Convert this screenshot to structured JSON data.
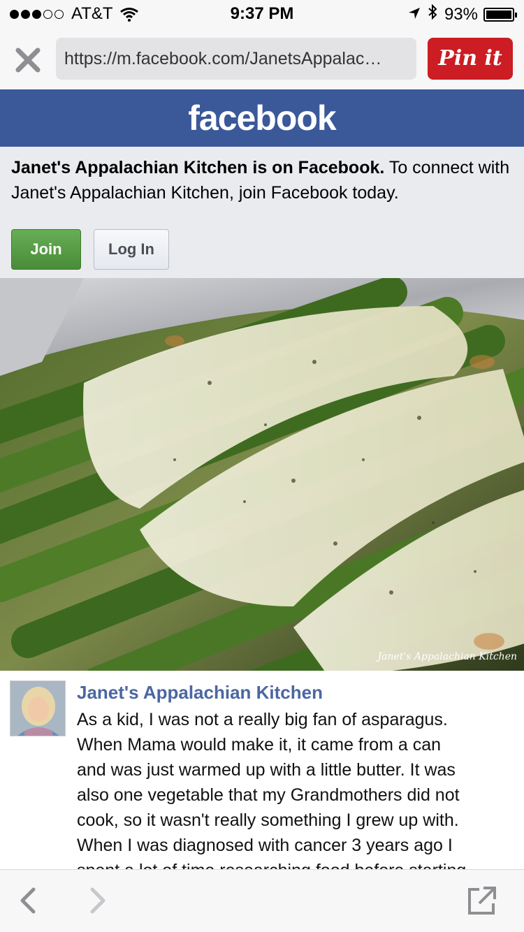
{
  "status_bar": {
    "carrier": "AT&T",
    "time": "9:37 PM",
    "battery_percent": "93%",
    "signal_bars_filled": 3,
    "signal_bars_total": 5
  },
  "browser": {
    "url": "https://m.facebook.com/JanetsAppalac…",
    "pin_it_label": "Pin it",
    "close_icon": "close-icon"
  },
  "facebook_header": {
    "logo_text": "facebook",
    "brand_color": "#3b5998"
  },
  "join_banner": {
    "page_name_bold": "Janet's Appalachian Kitchen is on Facebook.",
    "message": " To connect with Janet's Appalachian Kitchen, join Facebook today.",
    "join_label": "Join",
    "login_label": "Log In"
  },
  "photo": {
    "watermark": "Janet's Appalachian Kitchen"
  },
  "post": {
    "author": "Janet's Appalachian Kitchen",
    "lines": [
      "As a kid, I was not a really big fan of asparagus.",
      "When Mama would make it, it came from a can",
      "and was just warmed up with a little butter. It was",
      "also one vegetable that my Grandmothers did not",
      "cook, so it wasn't really something I grew up with.",
      "When I was diagnosed with cancer 3 years ago I",
      "spent a lot of time researching food before starting"
    ]
  },
  "toolbar": {
    "back_icon": "chevron-left-icon",
    "forward_icon": "chevron-right-icon",
    "share_icon": "share-external-icon"
  }
}
